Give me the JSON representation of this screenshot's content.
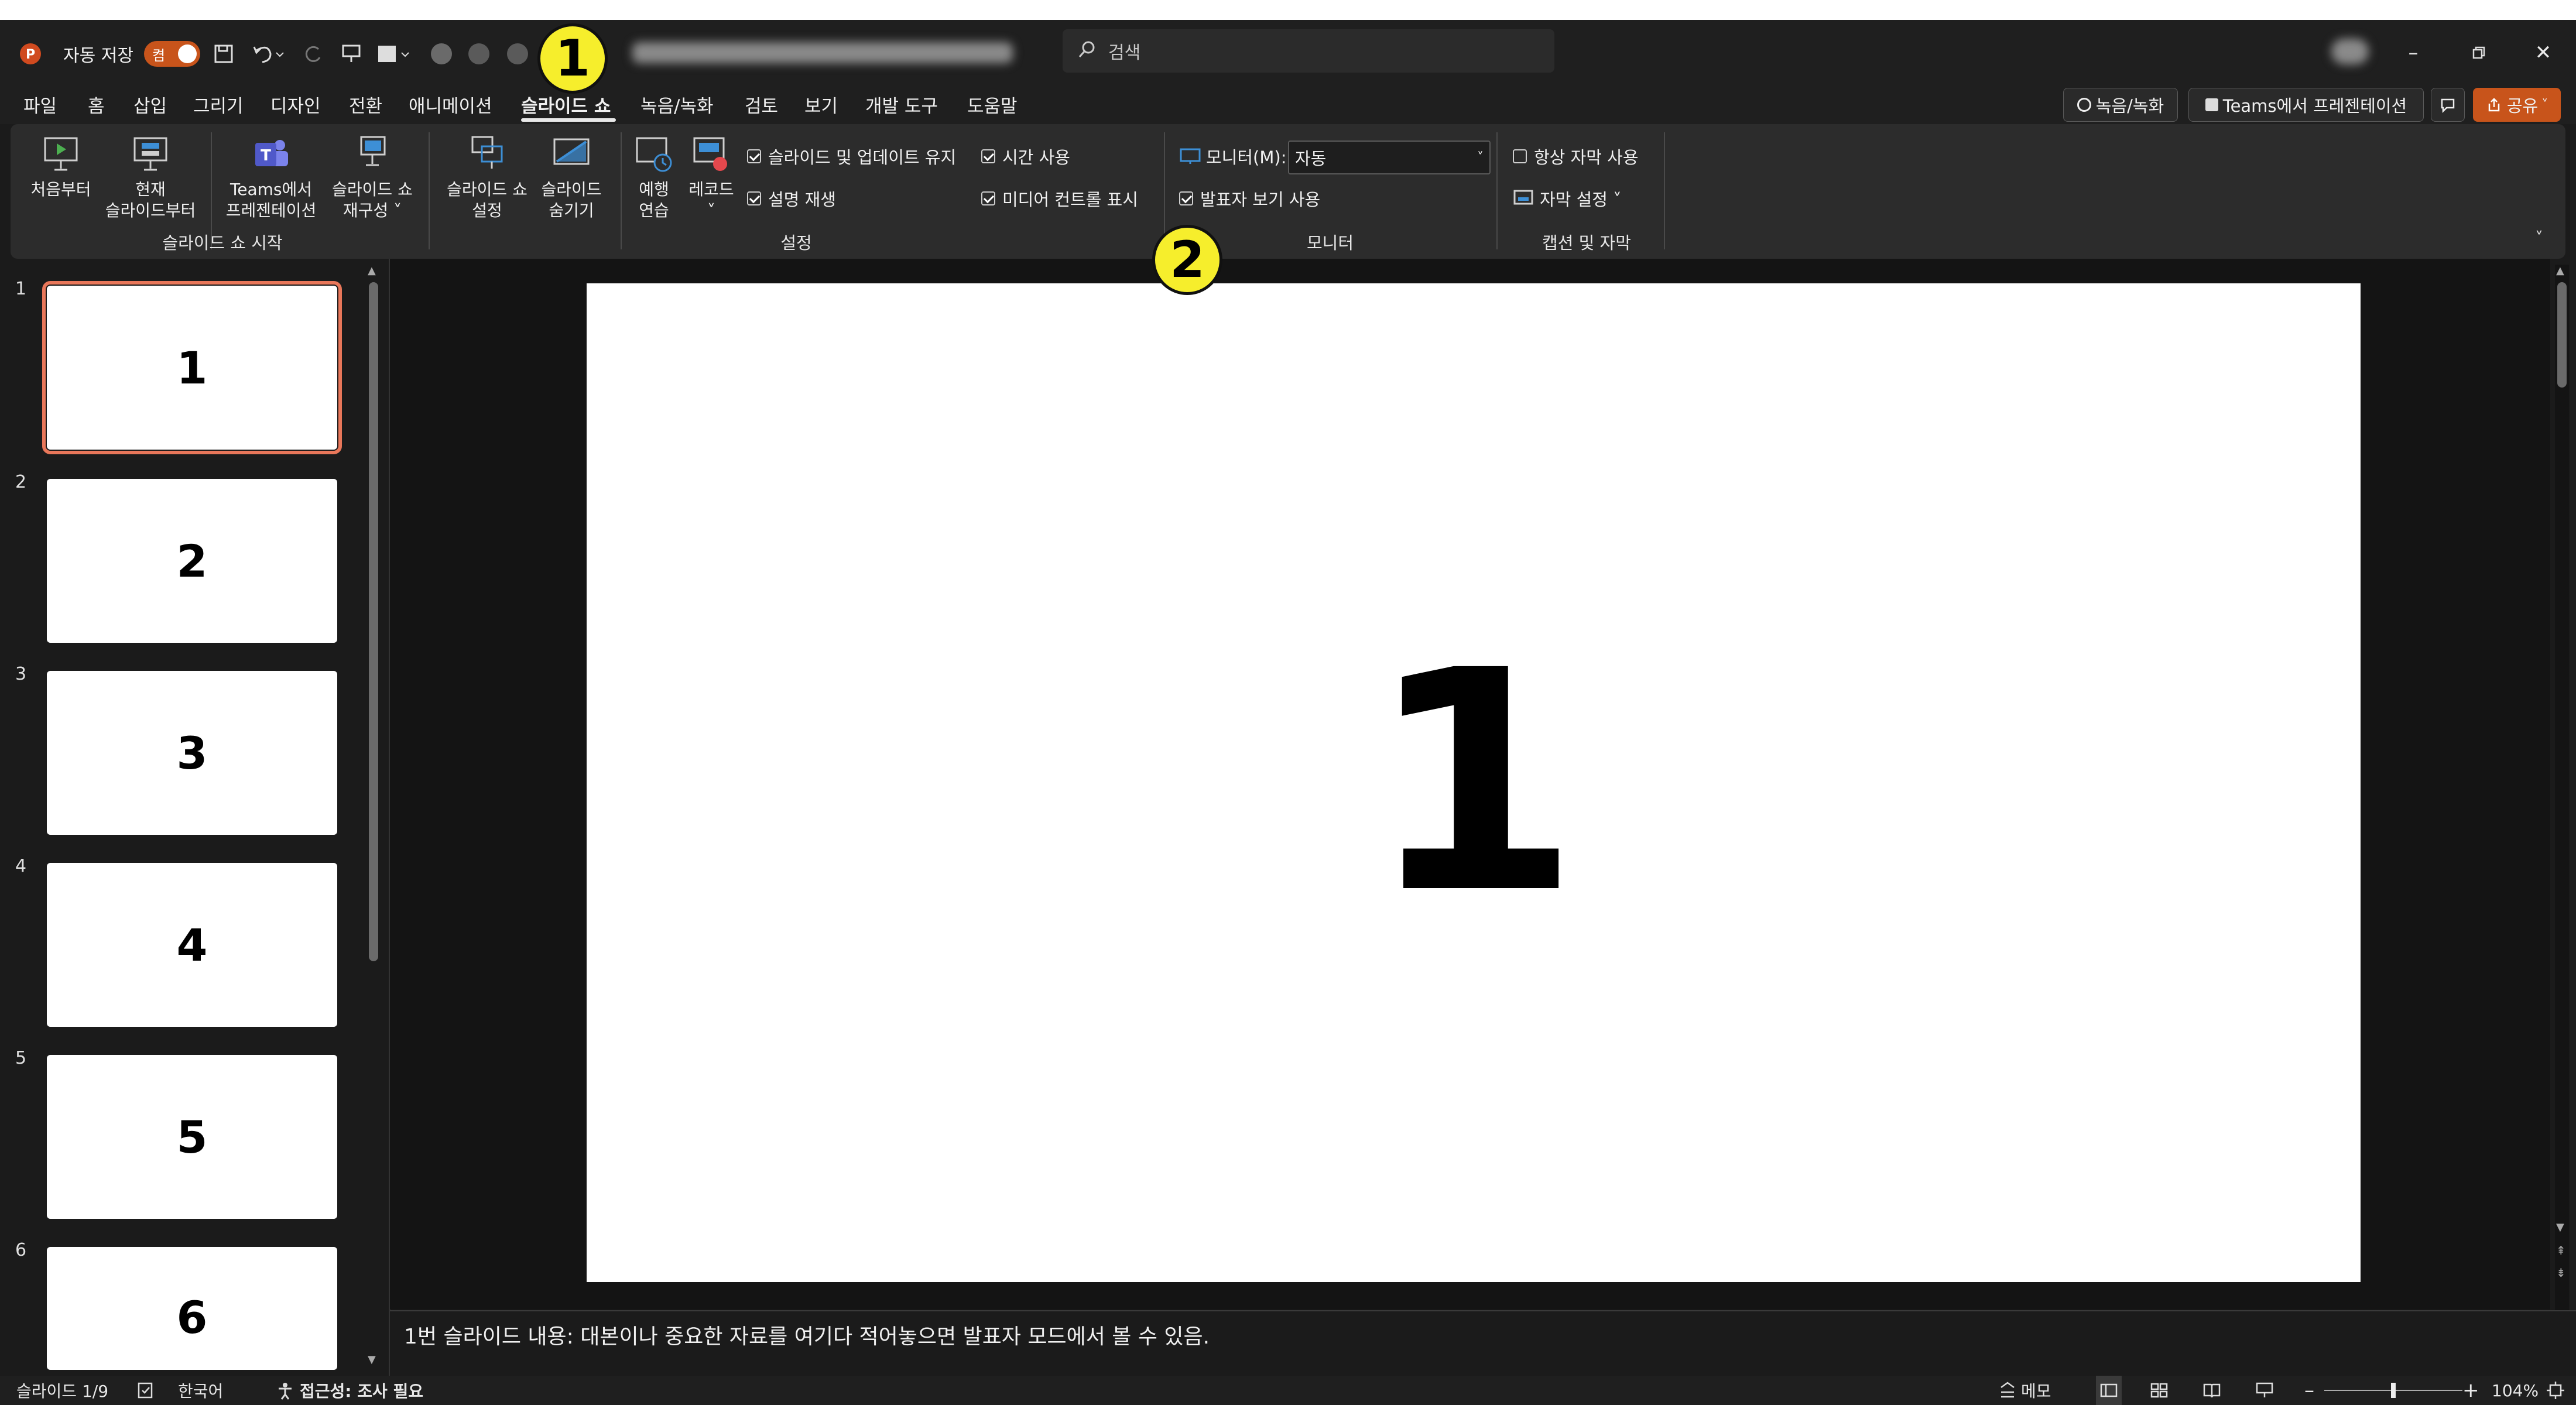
{
  "titlebar": {
    "autosave_label": "자동 저장",
    "autosave_state": "켬",
    "search_placeholder": "검색"
  },
  "menu": {
    "tabs": [
      "파일",
      "홈",
      "삽입",
      "그리기",
      "디자인",
      "전환",
      "애니메이션",
      "슬라이드 쇼",
      "녹음/녹화",
      "검토",
      "보기",
      "개발 도구",
      "도움말"
    ],
    "active_tab": "슬라이드 쇼",
    "record_button": "녹음/녹화",
    "teams_button": "Teams에서 프레젠테이션",
    "share_button": "공유"
  },
  "ribbon": {
    "start_group": {
      "label": "슬라이드 쇼 시작",
      "from_beginning": "처음부터",
      "from_current_1": "현재",
      "from_current_2": "슬라이드부터",
      "teams_1": "Teams에서",
      "teams_2": "프레젠테이션",
      "custom_1": "슬라이드 쇼",
      "custom_2": "재구성 ˅"
    },
    "setup_group": {
      "label": "설정",
      "setup_1": "슬라이드 쇼",
      "setup_2": "설정",
      "hide_1": "슬라이드",
      "hide_2": "숨기기",
      "rehearse_1": "예행",
      "rehearse_2": "연습",
      "record_1": "레코드",
      "record_2": "˅",
      "chk_keep_updated": "슬라이드 및 업데이트 유지",
      "chk_narration": "설명 재생",
      "chk_timings": "시간 사용",
      "chk_media": "미디어 컨트롤 표시"
    },
    "monitor_group": {
      "label": "모니터",
      "monitor_label": "모니터(M):",
      "monitor_value": "자동",
      "chk_presenter": "발표자 보기 사용"
    },
    "captions_group": {
      "label": "캡션 및 자막",
      "chk_always_subtitles": "항상 자막 사용",
      "subtitle_settings": "자막 설정 ˅"
    }
  },
  "slides": [
    {
      "num": "1",
      "title": "1"
    },
    {
      "num": "2",
      "title": "2"
    },
    {
      "num": "3",
      "title": "3"
    },
    {
      "num": "4",
      "title": "4"
    },
    {
      "num": "5",
      "title": "5"
    },
    {
      "num": "6",
      "title": "6"
    }
  ],
  "current_slide_text": "1",
  "notes": "1번 슬라이드 내용: 대본이나 중요한 자료를 여기다 적어놓으면 발표자 모드에서 볼 수 있음.",
  "status": {
    "slide_info": "슬라이드 1/9",
    "language": "한국어",
    "accessibility": "접근성: 조사 필요",
    "notes_btn": "메모",
    "zoom": "104%",
    "zoom_minus": "–",
    "zoom_plus": "+"
  },
  "callouts": [
    "1",
    "2"
  ],
  "colors": {
    "accent": "#c8541b",
    "selection": "#e9775a",
    "callout": "#f6ee2c"
  }
}
